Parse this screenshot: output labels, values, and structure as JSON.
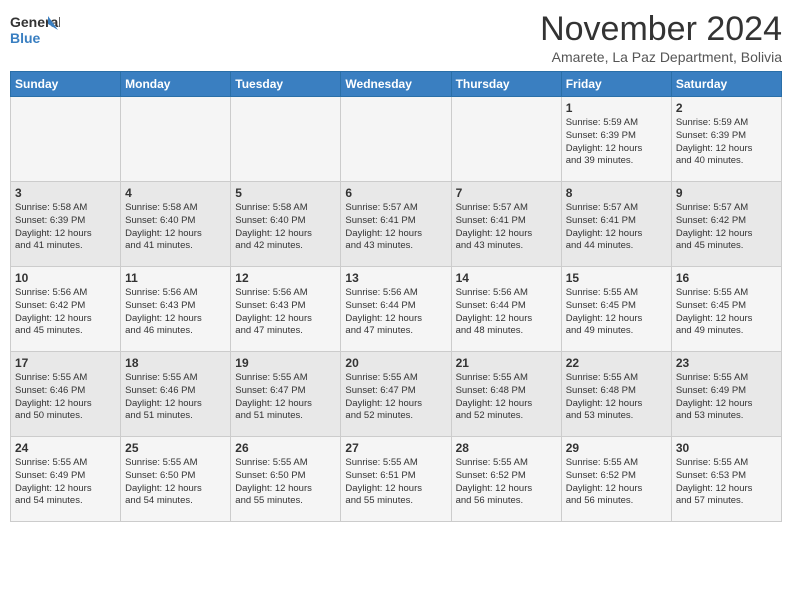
{
  "header": {
    "logo_line1": "General",
    "logo_line2": "Blue",
    "month": "November 2024",
    "location": "Amarete, La Paz Department, Bolivia"
  },
  "days_of_week": [
    "Sunday",
    "Monday",
    "Tuesday",
    "Wednesday",
    "Thursday",
    "Friday",
    "Saturday"
  ],
  "weeks": [
    [
      {
        "day": "",
        "info": ""
      },
      {
        "day": "",
        "info": ""
      },
      {
        "day": "",
        "info": ""
      },
      {
        "day": "",
        "info": ""
      },
      {
        "day": "",
        "info": ""
      },
      {
        "day": "1",
        "info": "Sunrise: 5:59 AM\nSunset: 6:39 PM\nDaylight: 12 hours\nand 39 minutes."
      },
      {
        "day": "2",
        "info": "Sunrise: 5:59 AM\nSunset: 6:39 PM\nDaylight: 12 hours\nand 40 minutes."
      }
    ],
    [
      {
        "day": "3",
        "info": "Sunrise: 5:58 AM\nSunset: 6:39 PM\nDaylight: 12 hours\nand 41 minutes."
      },
      {
        "day": "4",
        "info": "Sunrise: 5:58 AM\nSunset: 6:40 PM\nDaylight: 12 hours\nand 41 minutes."
      },
      {
        "day": "5",
        "info": "Sunrise: 5:58 AM\nSunset: 6:40 PM\nDaylight: 12 hours\nand 42 minutes."
      },
      {
        "day": "6",
        "info": "Sunrise: 5:57 AM\nSunset: 6:41 PM\nDaylight: 12 hours\nand 43 minutes."
      },
      {
        "day": "7",
        "info": "Sunrise: 5:57 AM\nSunset: 6:41 PM\nDaylight: 12 hours\nand 43 minutes."
      },
      {
        "day": "8",
        "info": "Sunrise: 5:57 AM\nSunset: 6:41 PM\nDaylight: 12 hours\nand 44 minutes."
      },
      {
        "day": "9",
        "info": "Sunrise: 5:57 AM\nSunset: 6:42 PM\nDaylight: 12 hours\nand 45 minutes."
      }
    ],
    [
      {
        "day": "10",
        "info": "Sunrise: 5:56 AM\nSunset: 6:42 PM\nDaylight: 12 hours\nand 45 minutes."
      },
      {
        "day": "11",
        "info": "Sunrise: 5:56 AM\nSunset: 6:43 PM\nDaylight: 12 hours\nand 46 minutes."
      },
      {
        "day": "12",
        "info": "Sunrise: 5:56 AM\nSunset: 6:43 PM\nDaylight: 12 hours\nand 47 minutes."
      },
      {
        "day": "13",
        "info": "Sunrise: 5:56 AM\nSunset: 6:44 PM\nDaylight: 12 hours\nand 47 minutes."
      },
      {
        "day": "14",
        "info": "Sunrise: 5:56 AM\nSunset: 6:44 PM\nDaylight: 12 hours\nand 48 minutes."
      },
      {
        "day": "15",
        "info": "Sunrise: 5:55 AM\nSunset: 6:45 PM\nDaylight: 12 hours\nand 49 minutes."
      },
      {
        "day": "16",
        "info": "Sunrise: 5:55 AM\nSunset: 6:45 PM\nDaylight: 12 hours\nand 49 minutes."
      }
    ],
    [
      {
        "day": "17",
        "info": "Sunrise: 5:55 AM\nSunset: 6:46 PM\nDaylight: 12 hours\nand 50 minutes."
      },
      {
        "day": "18",
        "info": "Sunrise: 5:55 AM\nSunset: 6:46 PM\nDaylight: 12 hours\nand 51 minutes."
      },
      {
        "day": "19",
        "info": "Sunrise: 5:55 AM\nSunset: 6:47 PM\nDaylight: 12 hours\nand 51 minutes."
      },
      {
        "day": "20",
        "info": "Sunrise: 5:55 AM\nSunset: 6:47 PM\nDaylight: 12 hours\nand 52 minutes."
      },
      {
        "day": "21",
        "info": "Sunrise: 5:55 AM\nSunset: 6:48 PM\nDaylight: 12 hours\nand 52 minutes."
      },
      {
        "day": "22",
        "info": "Sunrise: 5:55 AM\nSunset: 6:48 PM\nDaylight: 12 hours\nand 53 minutes."
      },
      {
        "day": "23",
        "info": "Sunrise: 5:55 AM\nSunset: 6:49 PM\nDaylight: 12 hours\nand 53 minutes."
      }
    ],
    [
      {
        "day": "24",
        "info": "Sunrise: 5:55 AM\nSunset: 6:49 PM\nDaylight: 12 hours\nand 54 minutes."
      },
      {
        "day": "25",
        "info": "Sunrise: 5:55 AM\nSunset: 6:50 PM\nDaylight: 12 hours\nand 54 minutes."
      },
      {
        "day": "26",
        "info": "Sunrise: 5:55 AM\nSunset: 6:50 PM\nDaylight: 12 hours\nand 55 minutes."
      },
      {
        "day": "27",
        "info": "Sunrise: 5:55 AM\nSunset: 6:51 PM\nDaylight: 12 hours\nand 55 minutes."
      },
      {
        "day": "28",
        "info": "Sunrise: 5:55 AM\nSunset: 6:52 PM\nDaylight: 12 hours\nand 56 minutes."
      },
      {
        "day": "29",
        "info": "Sunrise: 5:55 AM\nSunset: 6:52 PM\nDaylight: 12 hours\nand 56 minutes."
      },
      {
        "day": "30",
        "info": "Sunrise: 5:55 AM\nSunset: 6:53 PM\nDaylight: 12 hours\nand 57 minutes."
      }
    ]
  ]
}
